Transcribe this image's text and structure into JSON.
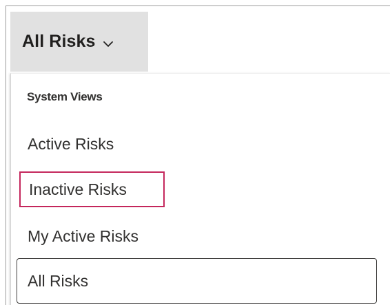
{
  "view_selector": {
    "label": "All Risks",
    "icon": "chevron-down-icon"
  },
  "dropdown": {
    "group_header": "System Views",
    "items": [
      {
        "label": "Active Risks",
        "state": "normal"
      },
      {
        "label": "Inactive Risks",
        "state": "highlighted"
      },
      {
        "label": "My Active Risks",
        "state": "normal"
      },
      {
        "label": "All Risks",
        "state": "selected"
      }
    ]
  },
  "colors": {
    "selector_background": "#e1e1e1",
    "highlight_border": "#c4265c",
    "selected_border": "#3b3a39",
    "text": "#323130"
  }
}
